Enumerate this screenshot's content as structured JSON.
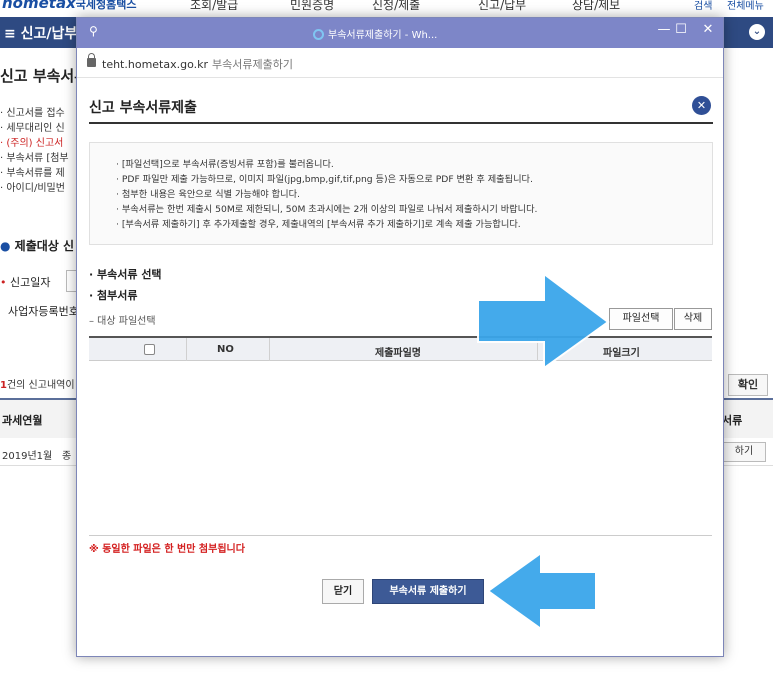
{
  "background": {
    "logo_text": "hometax",
    "logo_sub": "국세청홈택스",
    "menu": [
      "조회/발급",
      "민원증명",
      "신청/제출",
      "신고/납부",
      "상담/제보"
    ],
    "top_right": [
      "검색",
      "전체메뉴"
    ],
    "navbar_title": "≡  신고/납부",
    "navbar_button": "⌄",
    "page_title": "신고 부속서류",
    "info_lines": [
      "· 신고서를 접수",
      "· 세무대리인 신",
      "· (주의) 신고서",
      "· 부속서류 [첨부",
      "· 부속서류를 제",
      "· 아이디/비밀번"
    ],
    "section_title": "제출대상 신",
    "label_date": "신고일자",
    "label_bizno": "사업자등록번호",
    "result_count_num": "1",
    "result_count_text": "건의 신고내역이",
    "confirm_button": "확인",
    "col_period": "과세연월",
    "col_docs": "서류",
    "row_period": "2019년1월",
    "row_type": "종",
    "row_button": "하기"
  },
  "window": {
    "title": "부속서류제출하기 - Wh...",
    "pin_icon": "⚲",
    "minimize": "—",
    "maximize": "☐",
    "close": "✕",
    "url": "teht.hometax.go.kr",
    "page_name": "부속서류제출하기"
  },
  "dialog": {
    "title": "신고 부속서류제출",
    "close_label": "✕",
    "notices": [
      "· [파일선택]으로 부속서류(증빙서류 포함)를 불러옵니다.",
      "· PDF 파일만 제출 가능하므로, 이미지 파일(jpg,bmp,gif,tif,png 등)은 자동으로 PDF 변환 후 제출됩니다.",
      "· 첨부한 내용은 육안으로 식별 가능해야 합니다.",
      "· 부속서류는 한번 제출시 50M로 제한되니, 50M 초과시에는 2개 이상의 파일로 나눠서 제출하시기 바랍니다.",
      "· [부속서류 제출하기] 후 추가제출할 경우, 제출내역의 [부속서류 추가 제출하기]로 계속 제출 가능합니다."
    ],
    "section_select": "· 부속서류 선택",
    "section_attach": "· 첨부서류",
    "target_label": "– 대상 파일선택",
    "file_select_button": "파일선택",
    "delete_button": "삭제",
    "table_headers": {
      "no": "NO",
      "filename": "제출파일명",
      "filesize": "파일크기"
    },
    "warning": "※ 동일한 파일은 한 번만 첨부됩니다",
    "close_button": "닫기",
    "submit_button": "부속서류 제출하기"
  },
  "colors": {
    "navbar": "#2e4a82",
    "titlebar": "#7d86c8",
    "submit": "#3d5a96",
    "arrow": "#3aa6ea",
    "warning": "#d42020"
  }
}
